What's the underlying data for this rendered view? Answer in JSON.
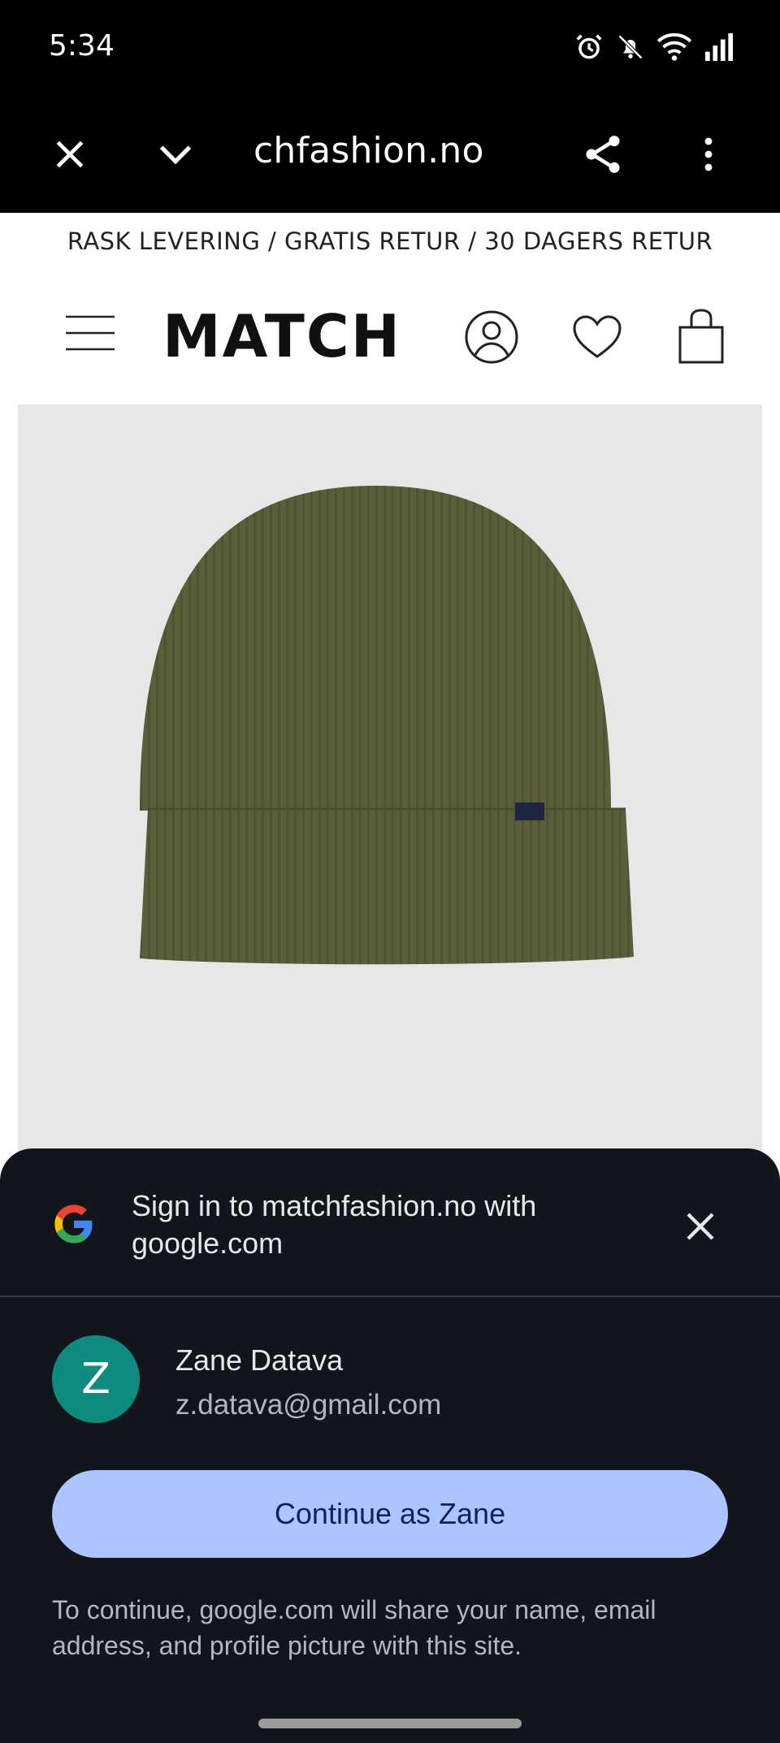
{
  "status_bar": {
    "time": "5:34",
    "icons": [
      "alarm-icon",
      "bell-muted-icon",
      "wifi-icon",
      "signal-icon"
    ]
  },
  "browser": {
    "url": "chfashion.no",
    "buttons": [
      "close-icon",
      "chevron-down-icon",
      "share-icon",
      "more-vert-icon"
    ]
  },
  "site": {
    "promo": "RASK LEVERING / GRATIS RETUR / 30 DAGERS RETUR",
    "logo": "MATCH",
    "header_icons": [
      "menu-icon",
      "account-icon",
      "heart-icon",
      "bag-icon"
    ]
  },
  "product": {
    "image_subject": "olive green ribbed beanie",
    "colors": {
      "beanie": "#5a5f3a",
      "background": "#e7e7e7"
    }
  },
  "signin_sheet": {
    "title": "Sign in to matchfashion.no with google.com",
    "account": {
      "initial": "Z",
      "name": "Zane Datava",
      "email": "z.datava@gmail.com"
    },
    "continue_label": "Continue as Zane",
    "disclaimer": "To continue, google.com will share your name, email address, and profile picture with this site.",
    "colors": {
      "sheet_bg": "#12151c",
      "button_bg": "#aec4ff",
      "avatar_bg": "#0e8a7e"
    }
  }
}
